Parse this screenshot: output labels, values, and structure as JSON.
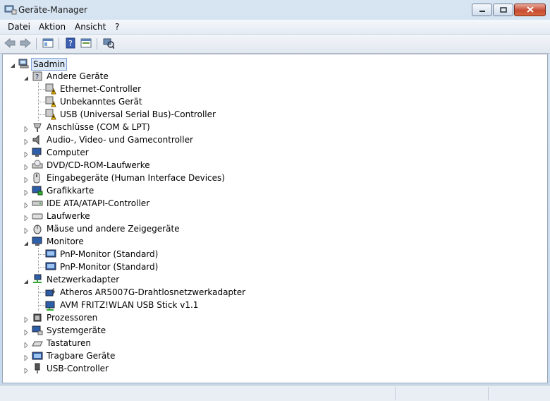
{
  "window": {
    "title": "Geräte-Manager",
    "controls": [
      "minimize-icon",
      "maximize-icon",
      "close-icon"
    ]
  },
  "menubar": {
    "items": [
      "Datei",
      "Aktion",
      "Ansicht",
      "?"
    ]
  },
  "toolbar": {
    "buttons": [
      "back-arrow-icon",
      "forward-arrow-icon",
      "properties-icon",
      "help-icon",
      "view-icon",
      "scan-hardware-icon"
    ]
  },
  "tree": {
    "root": "Sadmin",
    "categories": [
      {
        "label": "Andere Geräte",
        "expanded": true,
        "icon": "unknown-device-icon",
        "children": [
          "Ethernet-Controller",
          "Unbekanntes Gerät",
          "USB (Universal Serial Bus)-Controller"
        ]
      },
      {
        "label": "Anschlüsse (COM & LPT)",
        "expanded": false,
        "icon": "port-icon",
        "children": []
      },
      {
        "label": "Audio-, Video- und Gamecontroller",
        "expanded": false,
        "icon": "speaker-icon",
        "children": []
      },
      {
        "label": "Computer",
        "expanded": false,
        "icon": "computer-icon",
        "children": []
      },
      {
        "label": "DVD/CD-ROM-Laufwerke",
        "expanded": false,
        "icon": "cd-drive-icon",
        "children": []
      },
      {
        "label": "Eingabegeräte (Human Interface Devices)",
        "expanded": false,
        "icon": "hid-icon",
        "children": []
      },
      {
        "label": "Grafikkarte",
        "expanded": false,
        "icon": "display-adapter-icon",
        "children": []
      },
      {
        "label": "IDE ATA/ATAPI-Controller",
        "expanded": false,
        "icon": "ide-controller-icon",
        "children": []
      },
      {
        "label": "Laufwerke",
        "expanded": false,
        "icon": "disk-drive-icon",
        "children": []
      },
      {
        "label": "Mäuse und andere Zeigegeräte",
        "expanded": false,
        "icon": "mouse-icon",
        "children": []
      },
      {
        "label": "Monitore",
        "expanded": true,
        "icon": "monitor-icon",
        "children": [
          "PnP-Monitor (Standard)",
          "PnP-Monitor (Standard)"
        ]
      },
      {
        "label": "Netzwerkadapter",
        "expanded": true,
        "icon": "network-adapter-icon",
        "children": [
          "Atheros AR5007G-Drahtlosnetzwerkadapter",
          "AVM FRITZ!WLAN USB Stick v1.1"
        ]
      },
      {
        "label": "Prozessoren",
        "expanded": false,
        "icon": "processor-icon",
        "children": []
      },
      {
        "label": "Systemgeräte",
        "expanded": false,
        "icon": "system-device-icon",
        "children": []
      },
      {
        "label": "Tastaturen",
        "expanded": false,
        "icon": "keyboard-icon",
        "children": []
      },
      {
        "label": "Tragbare Geräte",
        "expanded": false,
        "icon": "portable-device-icon",
        "children": []
      },
      {
        "label": "USB-Controller",
        "expanded": false,
        "icon": "usb-icon",
        "children": []
      }
    ]
  },
  "colors": {
    "selection": "#dce8f7",
    "warning": "#f2c300",
    "tree_line": "#999999"
  }
}
